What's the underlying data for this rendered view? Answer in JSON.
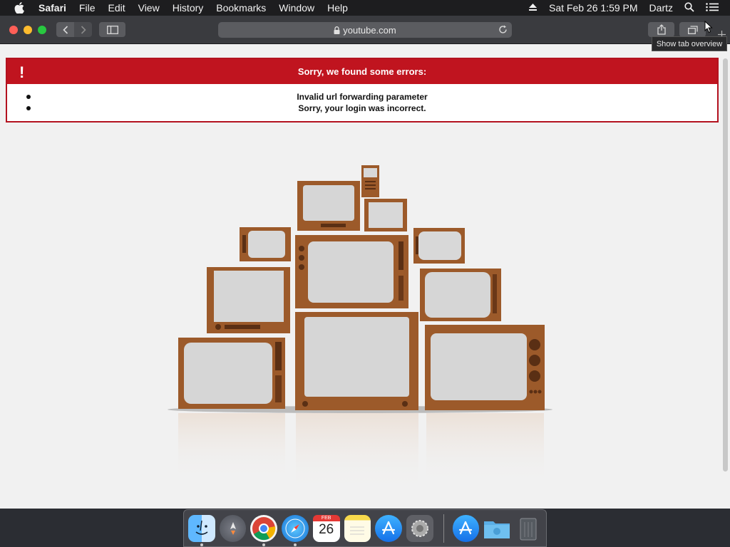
{
  "menubar": {
    "app": "Safari",
    "items": [
      "File",
      "Edit",
      "View",
      "History",
      "Bookmarks",
      "Window",
      "Help"
    ],
    "clock": "Sat Feb 26  1:59 PM",
    "user": "Dartz"
  },
  "toolbar": {
    "url": "youtube.com",
    "tooltip": "Show tab overview"
  },
  "errors": {
    "title": "Sorry, we found some errors:",
    "items": [
      "Invalid url forwarding parameter",
      "Sorry, your login was incorrect."
    ]
  },
  "dock": {
    "calendar_month": "FEB",
    "calendar_day": "26",
    "apps": [
      "finder-icon",
      "launchpad-icon",
      "chrome-icon",
      "safari-icon",
      "calendar-icon",
      "notes-icon",
      "app-store-icon",
      "system-preferences-icon",
      "app-store-icon",
      "downloads-folder-icon",
      "trash-icon"
    ]
  },
  "colors": {
    "error_red": "#c0141f",
    "page_bg": "#f1f1f1",
    "tv_wood": "#9c5a2a"
  }
}
